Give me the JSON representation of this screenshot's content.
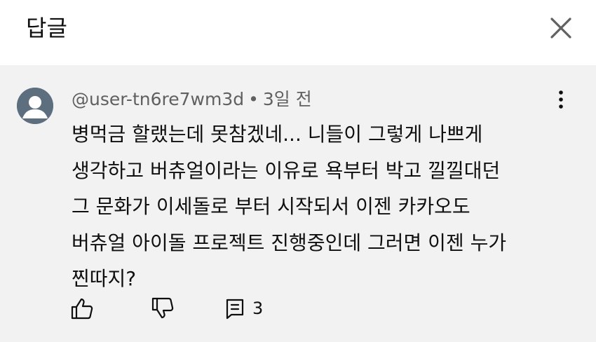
{
  "header": {
    "title": "답글",
    "close_icon": "close-icon"
  },
  "comment": {
    "avatar_icon": "default-avatar-icon",
    "username": "@user-tn6re7wm3d",
    "separator": "•",
    "time": "3일 전",
    "more_icon": "more-vert-icon",
    "text_lines": [
      "병먹금 할랬는데 못참겠네... 니들이 그렇게 나쁘게",
      "생각하고 버츄얼이라는 이유로 욕부터 박고 낄낄대던",
      "그 문화가 이세돌로 부터 시작되서 이젠 카카오도",
      "버츄얼 아이돌 프로젝트 진행중인데 그러면 이젠 누가",
      "찐따지?"
    ],
    "actions": {
      "like_icon": "thumbs-up-icon",
      "dislike_icon": "thumbs-down-icon",
      "reply_icon": "reply-icon",
      "reply_count": "3"
    }
  },
  "colors": {
    "panel_background": "#f2f2f2",
    "meta_text": "#606060",
    "primary_text": "#0f0f0f",
    "avatar": "#5d6f7f"
  }
}
